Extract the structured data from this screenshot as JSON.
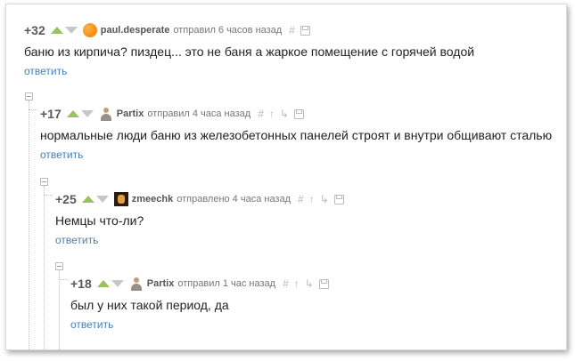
{
  "comments": [
    {
      "rating": "+32",
      "author": "paul.desperate",
      "action": "отправил",
      "time": "6 часов назад",
      "text": "баню из кирпича? пиздец... это не баня а жаркое помещение с горячей водой",
      "reply": "ответить",
      "avatar": "orange-circle-avatar"
    },
    {
      "rating": "+17",
      "author": "Partix",
      "action": "отправил",
      "time": "4 часа назад",
      "text": "нормальные люди баню из железобетонных панелей строят и внутри общивают сталью",
      "reply": "ответить",
      "avatar": "person-avatar"
    },
    {
      "rating": "+25",
      "author": "zmeechk",
      "action": "отправлено",
      "time": "4 часа назад",
      "text": "Немцы что-ли?",
      "reply": "ответить",
      "avatar": "dark-avatar"
    },
    {
      "rating": "+18",
      "author": "Partix",
      "action": "отправил",
      "time": "1 час назад",
      "text": "был у них такой период, да",
      "reply": "ответить",
      "avatar": "person-avatar"
    }
  ],
  "colors": {
    "upvote": "#97c45a",
    "downvote": "#c7c7c7",
    "link": "#4b7fb3"
  }
}
